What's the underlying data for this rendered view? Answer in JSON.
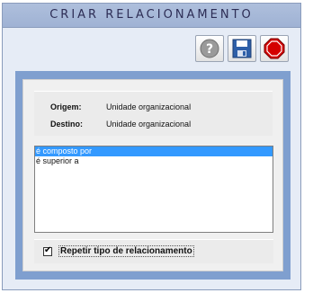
{
  "window": {
    "title": "CRIAR RELACIONAMENTO"
  },
  "toolbar": {
    "help_icon": "help-icon",
    "save_icon": "floppy-disk-icon",
    "close_icon": "stop-icon",
    "help_glyph": "?"
  },
  "info": {
    "origin_label": "Origem:",
    "origin_value": "Unidade organizacional",
    "destination_label": "Destino:",
    "destination_value": "Unidade organizacional"
  },
  "relationship_list": {
    "items": [
      "é composto por",
      "é superior a"
    ],
    "selected_index": 0
  },
  "repeat_option": {
    "label": "Repetir tipo de relacionamento",
    "checked": true,
    "check_glyph": "✔"
  },
  "colors": {
    "title_bar": "#a8bad9",
    "outer_panel": "#7f9fcf",
    "selection": "#3399ff",
    "stop_red": "#d40000"
  }
}
